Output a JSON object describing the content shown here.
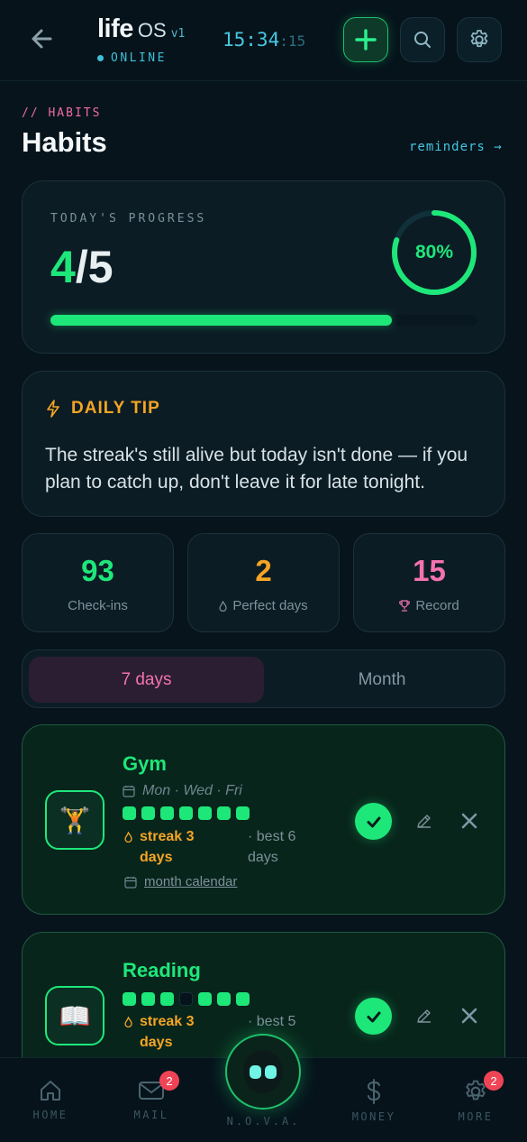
{
  "header": {
    "brand": "life",
    "brand_suffix": "OS",
    "version": "v1",
    "status": "ONLINE",
    "clock_main": "15:34",
    "clock_sec": ":15"
  },
  "page": {
    "kicker": "// HABITS",
    "title": "Habits",
    "reminders_link": "reminders →"
  },
  "progress": {
    "label": "TODAY'S PROGRESS",
    "done": "4",
    "total": "5",
    "percent_text": "80%",
    "fraction": 0.8
  },
  "tip": {
    "title": "DAILY TIP",
    "body": "The streak's still alive but today isn't done — if you plan to catch up, don't leave it for late tonight."
  },
  "stats": [
    {
      "value": "93",
      "label": "Check-ins",
      "color": "#1ee77a",
      "icon": ""
    },
    {
      "value": "2",
      "label": "Perfect days",
      "color": "#f5a524",
      "icon": "flame-icon"
    },
    {
      "value": "15",
      "label": "Record",
      "color": "#f472b0",
      "icon": "trophy-icon"
    }
  ],
  "segment": {
    "options": [
      "7 days",
      "Month"
    ],
    "selected": "7 days"
  },
  "habits": [
    {
      "name": "Gym",
      "emoji": "🏋️",
      "icon": "weightlifter-icon",
      "schedule": "Mon · Wed · Fri",
      "week": [
        true,
        true,
        true,
        true,
        true,
        true,
        true
      ],
      "streak": "streak 3 days",
      "best": "· best 6 days",
      "calendar_link": "month calendar",
      "done_today": true
    },
    {
      "name": "Reading",
      "emoji": "📖",
      "icon": "book-icon",
      "week": [
        true,
        true,
        true,
        false,
        true,
        true,
        true
      ],
      "streak": "streak 3 days",
      "best": "· best 5",
      "done_today": true
    }
  ],
  "nav": {
    "home": "HOME",
    "mail": "MAIL",
    "mail_badge": "2",
    "nova": "N.O.V.A.",
    "money": "MONEY",
    "more": "MORE",
    "more_badge": "2"
  },
  "colors": {
    "accent_green": "#1ee77a",
    "accent_orange": "#f5a524",
    "accent_pink": "#f472b0",
    "accent_cyan": "#43c6e0",
    "badge_red": "#ef4456"
  }
}
